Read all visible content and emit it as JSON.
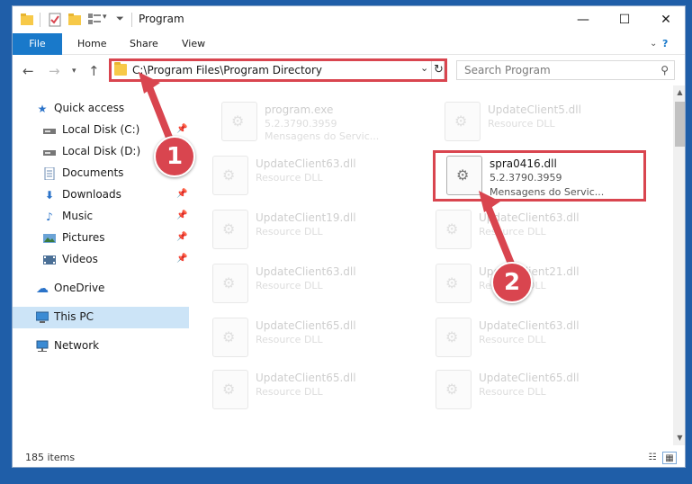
{
  "window": {
    "title": "Program"
  },
  "ribbon": {
    "tabs": [
      "File",
      "Home",
      "Share",
      "View"
    ]
  },
  "address": {
    "path": "C:\\Program Files\\Program Directory"
  },
  "search": {
    "placeholder": "Search Program"
  },
  "nav": {
    "items": [
      {
        "label": "Quick access",
        "icon": "star-icon",
        "pinned": false
      },
      {
        "label": "Local Disk (C:)",
        "icon": "drive-icon",
        "pinned": true
      },
      {
        "label": "Local Disk (D:)",
        "icon": "drive-icon",
        "pinned": false
      },
      {
        "label": "Documents",
        "icon": "document-icon",
        "pinned": true
      },
      {
        "label": "Downloads",
        "icon": "download-icon",
        "pinned": true
      },
      {
        "label": "Music",
        "icon": "music-icon",
        "pinned": true
      },
      {
        "label": "Pictures",
        "icon": "pictures-icon",
        "pinned": true
      },
      {
        "label": "Videos",
        "icon": "videos-icon",
        "pinned": true
      },
      {
        "label": "OneDrive",
        "icon": "cloud-icon",
        "pinned": false
      },
      {
        "label": "This PC",
        "icon": "computer-icon",
        "pinned": false,
        "selected": true
      },
      {
        "label": "Network",
        "icon": "network-icon",
        "pinned": false
      }
    ]
  },
  "files": [
    {
      "name": "program.exe",
      "desc": "5.2.3790.3959",
      "desc2": "Mensagens do Servic..."
    },
    {
      "name": "UpdateClient5.dll",
      "desc": "Resource DLL"
    },
    {
      "name": "UpdateClient63.dll",
      "desc": "Resource DLL"
    },
    {
      "name": "spra0416.dll",
      "desc": "5.2.3790.3959",
      "desc2": "Mensagens do Servic...",
      "highlight": true
    },
    {
      "name": "UpdateClient19.dll",
      "desc": "Resource DLL"
    },
    {
      "name": "UpdateClient63.dll",
      "desc": "Resource DLL"
    },
    {
      "name": "UpdateClient63.dll",
      "desc": "Resource DLL"
    },
    {
      "name": "UpdateClient21.dll",
      "desc": "Resource DLL"
    },
    {
      "name": "UpdateClient65.dll",
      "desc": "Resource DLL"
    },
    {
      "name": "UpdateClient63.dll",
      "desc": "Resource DLL"
    },
    {
      "name": "UpdateClient65.dll",
      "desc": "Resource DLL"
    },
    {
      "name": "UpdateClient65.dll",
      "desc": "Resource DLL"
    }
  ],
  "status": {
    "count": "185 items"
  },
  "callouts": {
    "one": "1",
    "two": "2"
  },
  "colors": {
    "accent": "#1979ca",
    "highlight": "#d9454f",
    "selection": "#cce4f7"
  }
}
